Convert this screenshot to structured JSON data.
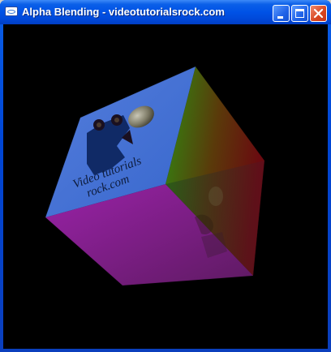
{
  "window": {
    "title": "Alpha Blending - videotutorialsrock.com"
  },
  "scene": {
    "background_color": "#000000",
    "cube_text_line1": "Video tutorials",
    "cube_text_line2": "rock.com",
    "face_colors": {
      "left": "#4a78e0",
      "bottom": "#8a1f9a",
      "right": "#2a6a10"
    }
  }
}
